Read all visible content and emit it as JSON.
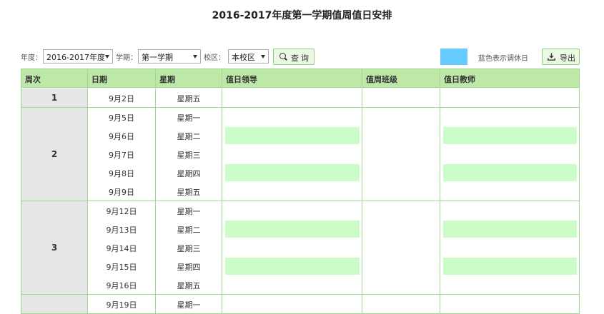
{
  "page": {
    "title": "2016-2017年度第一学期值周值日安排"
  },
  "filters": {
    "year_label": "年度：",
    "year_value": "2016-2017年度",
    "term_label": "学期：",
    "term_value": "第一学期",
    "campus_label": "校区：",
    "campus_value": "本校区",
    "query_label": "查询"
  },
  "legend": {
    "color": "#66ccff",
    "text": "蓝色表示调休日"
  },
  "export_label": "导出",
  "colors": {
    "header_bg": "#bde8a8",
    "border": "#9fd88f",
    "week_bg": "#e6e6e6",
    "highlight": "#ccfcc8"
  },
  "table": {
    "headers": [
      "周次",
      "日期",
      "星期",
      "值日领导",
      "值周班级",
      "值日教师"
    ],
    "weeks": [
      {
        "week": "1",
        "days": [
          {
            "date": "9月2日",
            "weekday": "星期五"
          }
        ]
      },
      {
        "week": "2",
        "days": [
          {
            "date": "9月5日",
            "weekday": "星期一"
          },
          {
            "date": "9月6日",
            "weekday": "星期二"
          },
          {
            "date": "9月7日",
            "weekday": "星期三"
          },
          {
            "date": "9月8日",
            "weekday": "星期四"
          },
          {
            "date": "9月9日",
            "weekday": "星期五"
          }
        ]
      },
      {
        "week": "3",
        "days": [
          {
            "date": "9月12日",
            "weekday": "星期一"
          },
          {
            "date": "9月13日",
            "weekday": "星期二"
          },
          {
            "date": "9月14日",
            "weekday": "星期三"
          },
          {
            "date": "9月15日",
            "weekday": "星期四"
          },
          {
            "date": "9月16日",
            "weekday": "星期五"
          }
        ]
      },
      {
        "week": "",
        "days": [
          {
            "date": "9月19日",
            "weekday": "星期一"
          }
        ]
      }
    ]
  }
}
